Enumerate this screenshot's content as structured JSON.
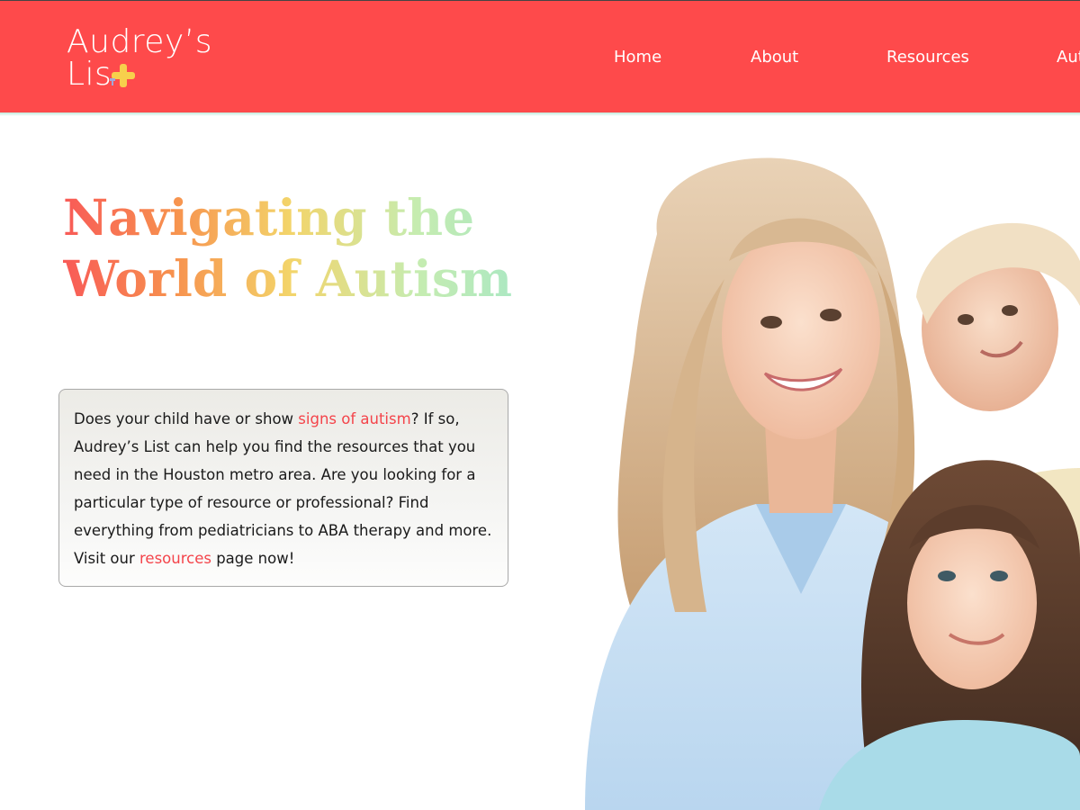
{
  "header": {
    "logo_line1": "Audrey’s",
    "logo_line2": "Lis",
    "nav": [
      "Home",
      "About",
      "Resources",
      "Aut"
    ]
  },
  "hero": {
    "title_line1": "Navigating the",
    "title_line2": "World of Autism"
  },
  "intro": {
    "text1": "Does your child have or show ",
    "link1": "signs of autism",
    "text2": "? If so, Audrey’s List can help you find the resources that you need in the Houston metro area. Are you looking for a particular type of resource or professional? Find everything from pediatricians to ABA therapy and more. Visit our ",
    "link2": "resources",
    "text3": " page now!"
  },
  "colors": {
    "header_bg": "#fe4a4b",
    "link": "#f4444a",
    "plus_yellow": "#f7cf4c"
  }
}
